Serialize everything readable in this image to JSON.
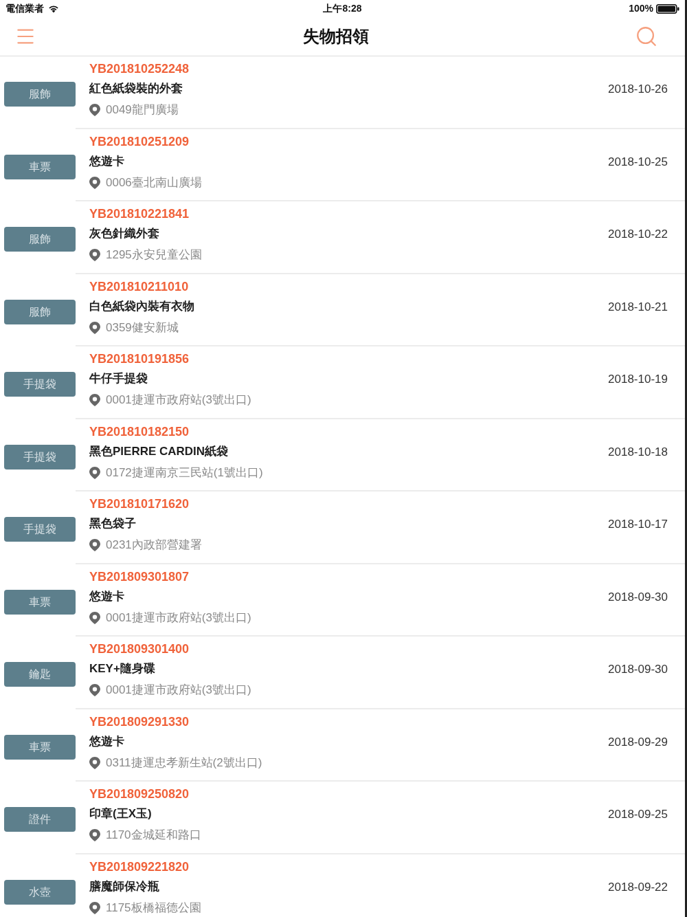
{
  "status_bar": {
    "carrier": "電信業者",
    "time": "上午8:28",
    "battery": "100%"
  },
  "nav_bar": {
    "title": "失物招領"
  },
  "items": [
    {
      "category": "服飾",
      "id": "YB201810252248",
      "name": "紅色紙袋裝的外套",
      "location": "0049龍門廣場",
      "date": "2018-10-26"
    },
    {
      "category": "車票",
      "id": "YB201810251209",
      "name": "悠遊卡",
      "location": "0006臺北南山廣場",
      "date": "2018-10-25"
    },
    {
      "category": "服飾",
      "id": "YB201810221841",
      "name": "灰色針織外套",
      "location": "1295永安兒童公園",
      "date": "2018-10-22"
    },
    {
      "category": "服飾",
      "id": "YB201810211010",
      "name": "白色紙袋內裝有衣物",
      "location": "0359健安新城",
      "date": "2018-10-21"
    },
    {
      "category": "手提袋",
      "id": "YB201810191856",
      "name": "牛仔手提袋",
      "location": "0001捷運市政府站(3號出口)",
      "date": "2018-10-19"
    },
    {
      "category": "手提袋",
      "id": "YB201810182150",
      "name": "黑色PIERRE CARDIN紙袋",
      "location": "0172捷運南京三民站(1號出口)",
      "date": "2018-10-18"
    },
    {
      "category": "手提袋",
      "id": "YB201810171620",
      "name": "黑色袋子",
      "location": "0231內政部營建署",
      "date": "2018-10-17"
    },
    {
      "category": "車票",
      "id": "YB201809301807",
      "name": "悠遊卡",
      "location": "0001捷運市政府站(3號出口)",
      "date": "2018-09-30"
    },
    {
      "category": "鑰匙",
      "id": "YB201809301400",
      "name": "KEY+隨身碟",
      "location": "0001捷運市政府站(3號出口)",
      "date": "2018-09-30"
    },
    {
      "category": "車票",
      "id": "YB201809291330",
      "name": "悠遊卡",
      "location": "0311捷運忠孝新生站(2號出口)",
      "date": "2018-09-29"
    },
    {
      "category": "證件",
      "id": "YB201809250820",
      "name": "印章(王X玉)",
      "location": "1170金城延和路口",
      "date": "2018-09-25"
    },
    {
      "category": "水壺",
      "id": "YB201809221820",
      "name": "膳魔師保冷瓶",
      "location": "1175板橋福德公園",
      "date": "2018-09-22"
    }
  ]
}
